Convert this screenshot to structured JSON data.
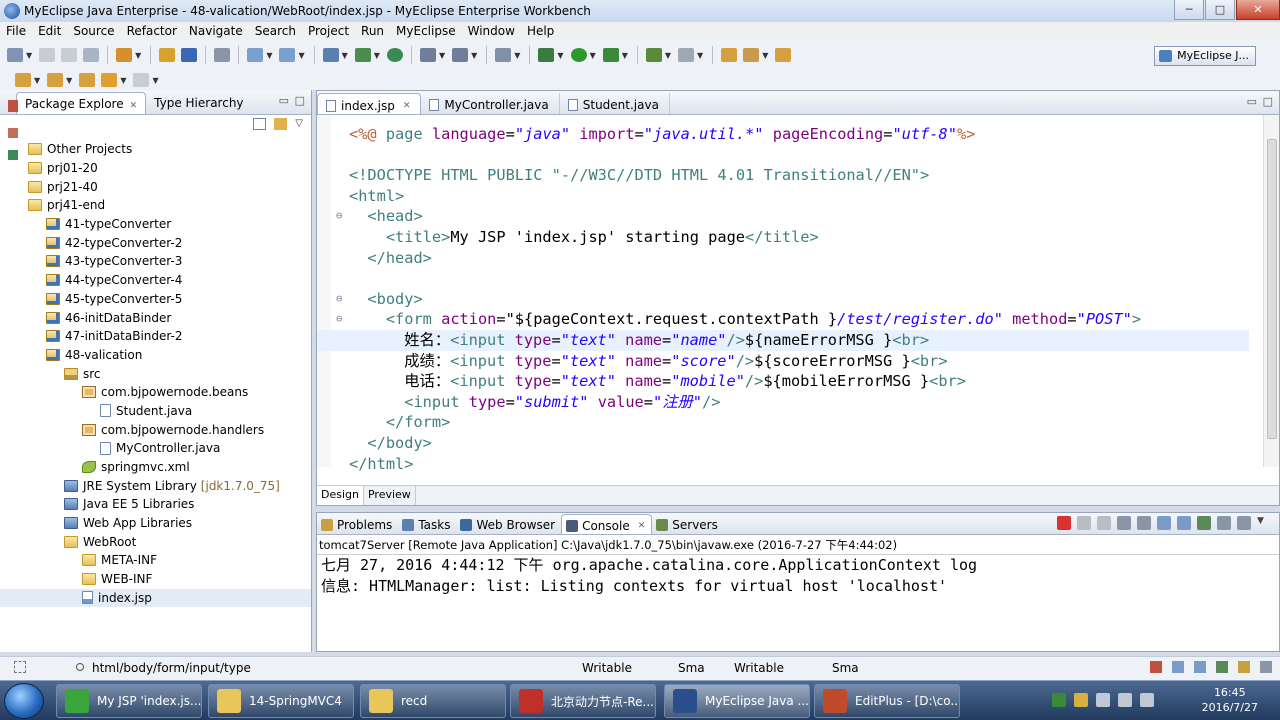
{
  "window": {
    "title": "MyEclipse Java Enterprise - 48-valication/WebRoot/index.jsp - MyEclipse Enterprise Workbench",
    "minimize": "─",
    "maximize": "□",
    "close": "✕"
  },
  "menu": [
    "File",
    "Edit",
    "Source",
    "Refactor",
    "Navigate",
    "Search",
    "Project",
    "Run",
    "MyEclipse",
    "Window",
    "Help"
  ],
  "perspective": {
    "label": "MyEclipse J..."
  },
  "package_explorer": {
    "tabs": [
      {
        "label": "Package Explore"
      },
      {
        "label": "Type Hierarchy"
      }
    ],
    "tree": [
      {
        "label": "Other Projects",
        "icon": "folder",
        "indent": 0
      },
      {
        "label": "prj01-20",
        "icon": "folder",
        "indent": 0
      },
      {
        "label": "prj21-40",
        "icon": "folder",
        "indent": 0
      },
      {
        "label": "prj41-end",
        "icon": "folder",
        "indent": 0
      },
      {
        "label": "41-typeConverter",
        "icon": "proj",
        "indent": 1
      },
      {
        "label": "42-typeConverter-2",
        "icon": "proj",
        "indent": 1
      },
      {
        "label": "43-typeConverter-3",
        "icon": "proj",
        "indent": 1
      },
      {
        "label": "44-typeConverter-4",
        "icon": "proj",
        "indent": 1
      },
      {
        "label": "45-typeConverter-5",
        "icon": "proj",
        "indent": 1
      },
      {
        "label": "46-initDataBinder",
        "icon": "proj",
        "indent": 1
      },
      {
        "label": "47-initDataBinder-2",
        "icon": "proj",
        "indent": 1
      },
      {
        "label": "48-valication",
        "icon": "proj",
        "indent": 1
      },
      {
        "label": "src",
        "icon": "src",
        "indent": 2
      },
      {
        "label": "com.bjpowernode.beans",
        "icon": "pkgi",
        "indent": 3
      },
      {
        "label": "Student.java",
        "icon": "java",
        "indent": 4
      },
      {
        "label": "com.bjpowernode.handlers",
        "icon": "pkgi",
        "indent": 3
      },
      {
        "label": "MyController.java",
        "icon": "java",
        "indent": 4
      },
      {
        "label": "springmvc.xml",
        "icon": "xml",
        "indent": 3
      },
      {
        "label": "JRE System Library",
        "suffix": "[jdk1.7.0_75]",
        "icon": "lib",
        "indent": 2
      },
      {
        "label": "Java EE 5 Libraries",
        "icon": "lib",
        "indent": 2
      },
      {
        "label": "Web App Libraries",
        "icon": "lib",
        "indent": 2
      },
      {
        "label": "WebRoot",
        "icon": "folder",
        "indent": 2
      },
      {
        "label": "META-INF",
        "icon": "folder",
        "indent": 3
      },
      {
        "label": "WEB-INF",
        "icon": "folder",
        "indent": 3
      },
      {
        "label": "index.jsp",
        "icon": "jsp",
        "indent": 3,
        "selected": true
      }
    ]
  },
  "editor": {
    "tabs": [
      {
        "label": "index.jsp",
        "active": true
      },
      {
        "label": "MyController.java"
      },
      {
        "label": "Student.java"
      }
    ],
    "code_lines": [
      [
        [
          "p",
          "<%@ "
        ],
        [
          "k",
          "page "
        ],
        [
          "a",
          "language"
        ],
        [
          "n",
          "="
        ],
        [
          "s",
          "\"java\""
        ],
        [
          "n",
          " "
        ],
        [
          "a",
          "import"
        ],
        [
          "n",
          "="
        ],
        [
          "s",
          "\"java.util.*\""
        ],
        [
          "n",
          " "
        ],
        [
          "a",
          "pageEncoding"
        ],
        [
          "n",
          "="
        ],
        [
          "s",
          "\"utf-8\""
        ],
        [
          "p",
          "%>"
        ]
      ],
      [],
      [
        [
          "d",
          "<!DOCTYPE HTML "
        ],
        [
          "k",
          "PUBLIC "
        ],
        [
          "s2",
          "\"-//W3C//DTD HTML 4.01 Transitional//EN\""
        ],
        [
          "d",
          ">"
        ]
      ],
      [
        [
          "k",
          "<html>"
        ]
      ],
      [
        [
          "n",
          "  "
        ],
        [
          "k",
          "<head>"
        ]
      ],
      [
        [
          "n",
          "    "
        ],
        [
          "k",
          "<title>"
        ],
        [
          "n",
          "My JSP 'index.jsp' starting page"
        ],
        [
          "k",
          "</title>"
        ]
      ],
      [
        [
          "n",
          "  "
        ],
        [
          "k",
          "</head>"
        ]
      ],
      [],
      [
        [
          "n",
          "  "
        ],
        [
          "k",
          "<body>"
        ]
      ],
      [
        [
          "n",
          "    "
        ],
        [
          "k",
          "<form "
        ],
        [
          "a",
          "action"
        ],
        [
          "n",
          "=\"${pageContext.request.contextPath }"
        ],
        [
          "s",
          "/test/register.do\""
        ],
        [
          "n",
          " "
        ],
        [
          "a",
          "method"
        ],
        [
          "n",
          "="
        ],
        [
          "s",
          "\"POST\""
        ],
        [
          "k",
          ">"
        ]
      ],
      [
        [
          "n",
          "      姓名："
        ],
        [
          "k",
          "<input "
        ],
        [
          "a",
          "type"
        ],
        [
          "n",
          "="
        ],
        [
          "s",
          "\"text\""
        ],
        [
          "n",
          " "
        ],
        [
          "a",
          "name"
        ],
        [
          "n",
          "="
        ],
        [
          "s",
          "\"name\""
        ],
        [
          "k",
          "/>"
        ],
        [
          "n",
          "${nameErrorMSG }"
        ],
        [
          "k",
          "<br>"
        ]
      ],
      [
        [
          "n",
          "      成绩："
        ],
        [
          "k",
          "<input "
        ],
        [
          "a",
          "type"
        ],
        [
          "n",
          "="
        ],
        [
          "s",
          "\"text\""
        ],
        [
          "n",
          " "
        ],
        [
          "a",
          "name"
        ],
        [
          "n",
          "="
        ],
        [
          "s",
          "\"score\""
        ],
        [
          "k",
          "/>"
        ],
        [
          "n",
          "${scoreErrorMSG }"
        ],
        [
          "k",
          "<br>"
        ]
      ],
      [
        [
          "n",
          "      电话："
        ],
        [
          "k",
          "<input "
        ],
        [
          "a",
          "type"
        ],
        [
          "n",
          "="
        ],
        [
          "s",
          "\"text\""
        ],
        [
          "n",
          " "
        ],
        [
          "a",
          "name"
        ],
        [
          "n",
          "="
        ],
        [
          "s",
          "\"mobile\""
        ],
        [
          "k",
          "/>"
        ],
        [
          "n",
          "${mobileErrorMSG }"
        ],
        [
          "k",
          "<br>"
        ]
      ],
      [
        [
          "n",
          "      "
        ],
        [
          "k",
          "<input "
        ],
        [
          "a",
          "type"
        ],
        [
          "n",
          "="
        ],
        [
          "s",
          "\"submit\""
        ],
        [
          "n",
          " "
        ],
        [
          "a",
          "value"
        ],
        [
          "n",
          "="
        ],
        [
          "s",
          "\"注册\""
        ],
        [
          "k",
          "/>"
        ]
      ],
      [
        [
          "n",
          "    "
        ],
        [
          "k",
          "</form>"
        ]
      ],
      [
        [
          "n",
          "  "
        ],
        [
          "k",
          "</body>"
        ]
      ],
      [
        [
          "k",
          "</html>"
        ]
      ]
    ],
    "design_tabs": [
      "Design",
      "Preview"
    ]
  },
  "console": {
    "tabs": [
      {
        "label": "Problems"
      },
      {
        "label": "Tasks"
      },
      {
        "label": "Web Browser"
      },
      {
        "label": "Console",
        "active": true
      },
      {
        "label": "Servers"
      }
    ],
    "info": "tomcat7Server [Remote Java Application] C:\\Java\\jdk1.7.0_75\\bin\\javaw.exe (2016-7-27 下午4:44:02)",
    "lines": [
      "七月 27, 2016 4:44:12 下午 org.apache.catalina.core.ApplicationContext log",
      "信息: HTMLManager: list: Listing contexts for virtual host 'localhost'"
    ]
  },
  "status": {
    "path": "html/body/form/input/type",
    "writable1": "Writable",
    "smart1": "Sma",
    "writable2": "Writable",
    "smart2": "Sma"
  },
  "taskbar": {
    "items": [
      {
        "label": "My JSP 'index.js...",
        "color": "#3aa53a"
      },
      {
        "label": "14-SpringMVC4",
        "color": "#e8c65a"
      },
      {
        "label": "recd",
        "color": "#e8c65a"
      },
      {
        "label": "北京动力节点-Re...",
        "color": "#c0302a"
      },
      {
        "label": "MyEclipse Java ...",
        "color": "#2a4f8a",
        "active": true
      },
      {
        "label": "EditPlus - [D:\\co...",
        "color": "#c04a2a"
      }
    ],
    "time": "16:45",
    "date": "2016/7/27"
  },
  "colors": {
    "keyword": "#3f7f7f",
    "string": "#2a00ff",
    "attribute": "#7f007f",
    "directive": "#bf5f3f"
  }
}
